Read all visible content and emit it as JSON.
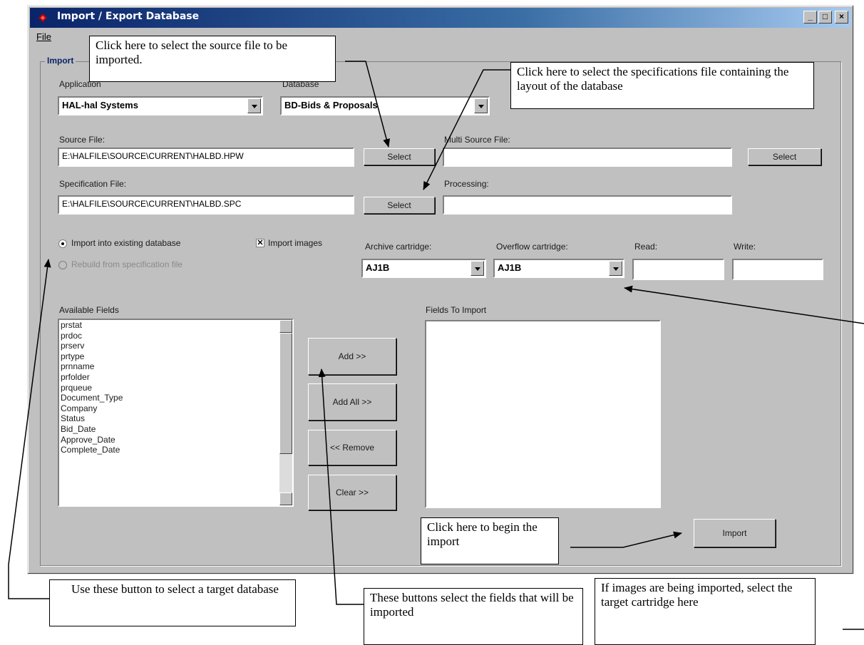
{
  "window": {
    "title": "Import / Export Database",
    "minimize_label": "_",
    "maximize_label": "□",
    "close_label": "×"
  },
  "menu": {
    "file_label": "File"
  },
  "group": {
    "label": "Import"
  },
  "application": {
    "label": "Application",
    "value": "HAL-hal Systems"
  },
  "database": {
    "label": "Database",
    "value": "BD-Bids & Proposals"
  },
  "source_file": {
    "label": "Source File:",
    "value": "E:\\HALFILE\\SOURCE\\CURRENT\\HALBD.HPW",
    "button": "Select"
  },
  "multi_source_file": {
    "label": "Multi Source File:",
    "value": "",
    "button": "Select"
  },
  "spec_file": {
    "label": "Specification File:",
    "value": "E:\\HALFILE\\SOURCE\\CURRENT\\HALBD.SPC",
    "button": "Select"
  },
  "processing": {
    "label": "Processing:",
    "value": ""
  },
  "options": {
    "import_existing": "Import into existing database",
    "rebuild": "Rebuild from specification file",
    "import_images": "Import images",
    "import_existing_selected": true,
    "import_images_checked": true
  },
  "archive_cartridge": {
    "label": "Archive cartridge:",
    "value": "AJ1B"
  },
  "overflow_cartridge": {
    "label": "Overflow cartridge:",
    "value": "AJ1B"
  },
  "read": {
    "label": "Read:",
    "value": ""
  },
  "write": {
    "label": "Write:",
    "value": ""
  },
  "available_fields": {
    "label": "Available Fields",
    "items": [
      "prstat",
      "prdoc",
      "prserv",
      "prtype",
      "prnname",
      "prfolder",
      "prqueue",
      "Document_Type",
      "Company",
      "Status",
      "Bid_Date",
      "Approve_Date",
      "Complete_Date"
    ]
  },
  "fields_to_import": {
    "label": "Fields To Import",
    "items": []
  },
  "buttons": {
    "add": "Add >>",
    "add_all": "Add All >>",
    "remove": "<< Remove",
    "clear": "Clear >>",
    "import": "Import"
  },
  "callouts": {
    "source": "Click here to select the source file to be imported.",
    "spec": "Click here to select the specifications file containing the layout of the database",
    "begin": "Click here to begin the import",
    "target_db": "Use these button to select a target database",
    "fields": "These buttons select the fields that will be imported",
    "cartridge": "If images are being imported, select the target cartridge here"
  }
}
